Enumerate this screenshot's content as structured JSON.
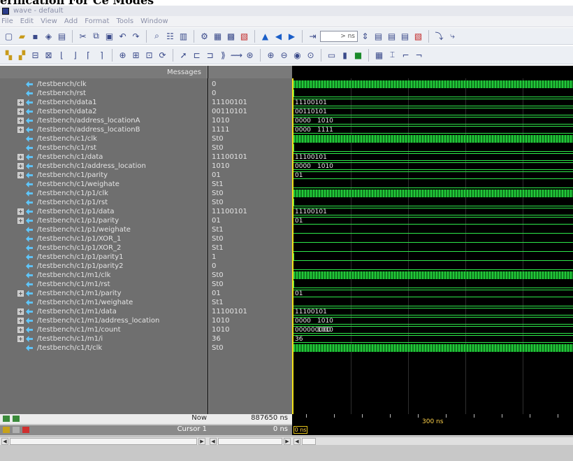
{
  "page": {
    "heading": "erification For Ce Modes"
  },
  "window": {
    "title": "wave - default"
  },
  "menu": [
    "File",
    "Edit",
    "View",
    "Add",
    "Format",
    "Tools",
    "Window"
  ],
  "toolbar1": {
    "time_field": "> ns"
  },
  "panes": {
    "messages_header": "Messages"
  },
  "signals": [
    {
      "name": "/testbench/clk",
      "value": "0",
      "expandable": false
    },
    {
      "name": "/testbench/rst",
      "value": "0",
      "expandable": false
    },
    {
      "name": "/testbench/data1",
      "value": "11100101",
      "expandable": true
    },
    {
      "name": "/testbench/data2",
      "value": "00110101",
      "expandable": true
    },
    {
      "name": "/testbench/address_locationA",
      "value": "1010",
      "expandable": true
    },
    {
      "name": "/testbench/address_locationB",
      "value": "1111",
      "expandable": true
    },
    {
      "name": "/testbench/c1/clk",
      "value": "St0",
      "expandable": false
    },
    {
      "name": "/testbench/c1/rst",
      "value": "St0",
      "expandable": false
    },
    {
      "name": "/testbench/c1/data",
      "value": "11100101",
      "expandable": true
    },
    {
      "name": "/testbench/c1/address_location",
      "value": "1010",
      "expandable": true
    },
    {
      "name": "/testbench/c1/parity",
      "value": "01",
      "expandable": true
    },
    {
      "name": "/testbench/c1/weighate",
      "value": "St1",
      "expandable": false
    },
    {
      "name": "/testbench/c1/p1/clk",
      "value": "St0",
      "expandable": false
    },
    {
      "name": "/testbench/c1/p1/rst",
      "value": "St0",
      "expandable": false
    },
    {
      "name": "/testbench/c1/p1/data",
      "value": "11100101",
      "expandable": true
    },
    {
      "name": "/testbench/c1/p1/parity",
      "value": "01",
      "expandable": true
    },
    {
      "name": "/testbench/c1/p1/weighate",
      "value": "St1",
      "expandable": false
    },
    {
      "name": "/testbench/c1/p1/XOR_1",
      "value": "St0",
      "expandable": false
    },
    {
      "name": "/testbench/c1/p1/XOR_2",
      "value": "St1",
      "expandable": false
    },
    {
      "name": "/testbench/c1/p1/parity1",
      "value": "1",
      "expandable": false
    },
    {
      "name": "/testbench/c1/p1/parity2",
      "value": "0",
      "expandable": false
    },
    {
      "name": "/testbench/c1/m1/clk",
      "value": "St0",
      "expandable": false
    },
    {
      "name": "/testbench/c1/m1/rst",
      "value": "St0",
      "expandable": false
    },
    {
      "name": "/testbench/c1/m1/parity",
      "value": "01",
      "expandable": true
    },
    {
      "name": "/testbench/c1/m1/weighate",
      "value": "St1",
      "expandable": false
    },
    {
      "name": "/testbench/c1/m1/data",
      "value": "11100101",
      "expandable": true
    },
    {
      "name": "/testbench/c1/m1/address_location",
      "value": "1010",
      "expandable": true
    },
    {
      "name": "/testbench/c1/m1/count",
      "value": "1010",
      "expandable": true
    },
    {
      "name": "/testbench/c1/m1/i",
      "value": "36",
      "expandable": true
    },
    {
      "name": "/testbench/c1/t/clk",
      "value": "St0",
      "expandable": false
    }
  ],
  "waves": [
    {
      "kind": "clock"
    },
    {
      "kind": "low",
      "step": true
    },
    {
      "kind": "bus",
      "segments": [
        {
          "label": "11100101"
        }
      ]
    },
    {
      "kind": "bus",
      "segments": [
        {
          "label": "00110101"
        }
      ]
    },
    {
      "kind": "bus",
      "segments": [
        {
          "label": "0000"
        },
        {
          "label": "1010"
        }
      ]
    },
    {
      "kind": "bus",
      "segments": [
        {
          "label": "0000"
        },
        {
          "label": "1111"
        }
      ]
    },
    {
      "kind": "clock"
    },
    {
      "kind": "low",
      "step": true
    },
    {
      "kind": "bus",
      "segments": [
        {
          "label": "11100101"
        }
      ]
    },
    {
      "kind": "bus",
      "segments": [
        {
          "label": "0000"
        },
        {
          "label": "1010"
        }
      ]
    },
    {
      "kind": "bus",
      "segments": [
        {
          "label": "01"
        }
      ]
    },
    {
      "kind": "low",
      "step": false
    },
    {
      "kind": "clock"
    },
    {
      "kind": "low",
      "step": true
    },
    {
      "kind": "bus",
      "segments": [
        {
          "label": "11100101"
        }
      ]
    },
    {
      "kind": "bus",
      "segments": [
        {
          "label": "01"
        }
      ]
    },
    {
      "kind": "low",
      "step": false
    },
    {
      "kind": "low",
      "step": false
    },
    {
      "kind": "low",
      "step": false
    },
    {
      "kind": "low",
      "step": true
    },
    {
      "kind": "low",
      "step": false
    },
    {
      "kind": "clock"
    },
    {
      "kind": "low",
      "step": true
    },
    {
      "kind": "bus",
      "segments": [
        {
          "label": "01"
        }
      ]
    },
    {
      "kind": "low",
      "step": false
    },
    {
      "kind": "bus",
      "segments": [
        {
          "label": "11100101"
        }
      ]
    },
    {
      "kind": "bus",
      "segments": [
        {
          "label": "0000"
        },
        {
          "label": "1010"
        }
      ]
    },
    {
      "kind": "bus",
      "segments": [
        {
          "label": "000000000"
        },
        {
          "label": "1010"
        }
      ]
    },
    {
      "kind": "bus",
      "segments": [
        {
          "label": "36"
        }
      ]
    },
    {
      "kind": "clock"
    }
  ],
  "status": {
    "now_label": "Now",
    "now_value": "887650 ns",
    "cursor_label": "Cursor 1",
    "cursor_value": "0 ns",
    "timeline_tick": "300 ns",
    "cursor_box": "0 ns"
  },
  "colors": {
    "wave_green": "#2ee84a",
    "cursor_yellow": "#f2e21a",
    "pane_gray": "#6f6f6f"
  }
}
